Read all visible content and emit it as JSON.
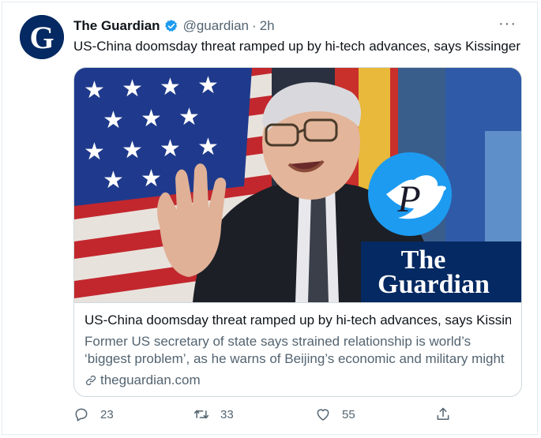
{
  "tweet": {
    "display_name": "The Guardian",
    "handle": "@guardian",
    "separator": "·",
    "time": "2h",
    "more": "···",
    "text": "US-China doomsday threat ramped up by hi-tech advances, says Kissinger",
    "avatar_letter": "G"
  },
  "card": {
    "image_logo_line1": "The",
    "image_logo_line2": "Guardian",
    "image_watermark_letter": "P",
    "title": "US-China doomsday threat ramped up by hi-tech advances, says Kissin...",
    "description": "Former US secretary of state says strained relationship is world’s ‘biggest problem’, as he warns of Beijing’s economic and military might",
    "domain": "theguardian.com"
  },
  "actions": {
    "reply_count": "23",
    "retweet_count": "33",
    "like_count": "55"
  },
  "colors": {
    "guardian_navy": "#052962",
    "twitter_blue": "#1d9bf0",
    "text_primary": "#0f1419",
    "text_secondary": "#536471"
  },
  "icons": [
    "verified-badge-icon",
    "more-icon",
    "link-icon",
    "reply-icon",
    "retweet-icon",
    "like-icon",
    "share-icon"
  ]
}
